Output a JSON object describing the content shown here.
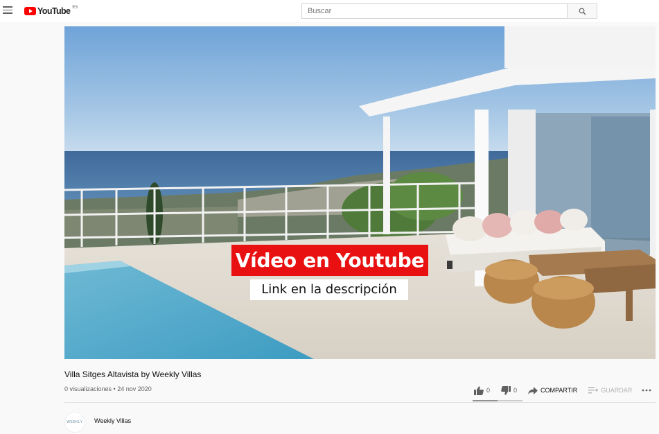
{
  "header": {
    "logo_text": "YouTube",
    "region": "ES",
    "search_placeholder": "Buscar"
  },
  "video": {
    "overlay_title": "Vídeo en Youtube",
    "overlay_subtitle": "Link en la descripción",
    "title": "Villa Sitges Altavista by Weekly Villas",
    "meta": "0 visualizaciones • 24 nov 2020"
  },
  "actions": {
    "likes": "0",
    "dislikes": "0",
    "share": "COMPARTIR",
    "save": "GUARDAR",
    "like_ratio": 0.5
  },
  "channel": {
    "name": "Weekly Villas",
    "avatar_text": "WEEKLY"
  },
  "colors": {
    "brand_red": "#ff0000",
    "overlay_red": "#e81010"
  }
}
